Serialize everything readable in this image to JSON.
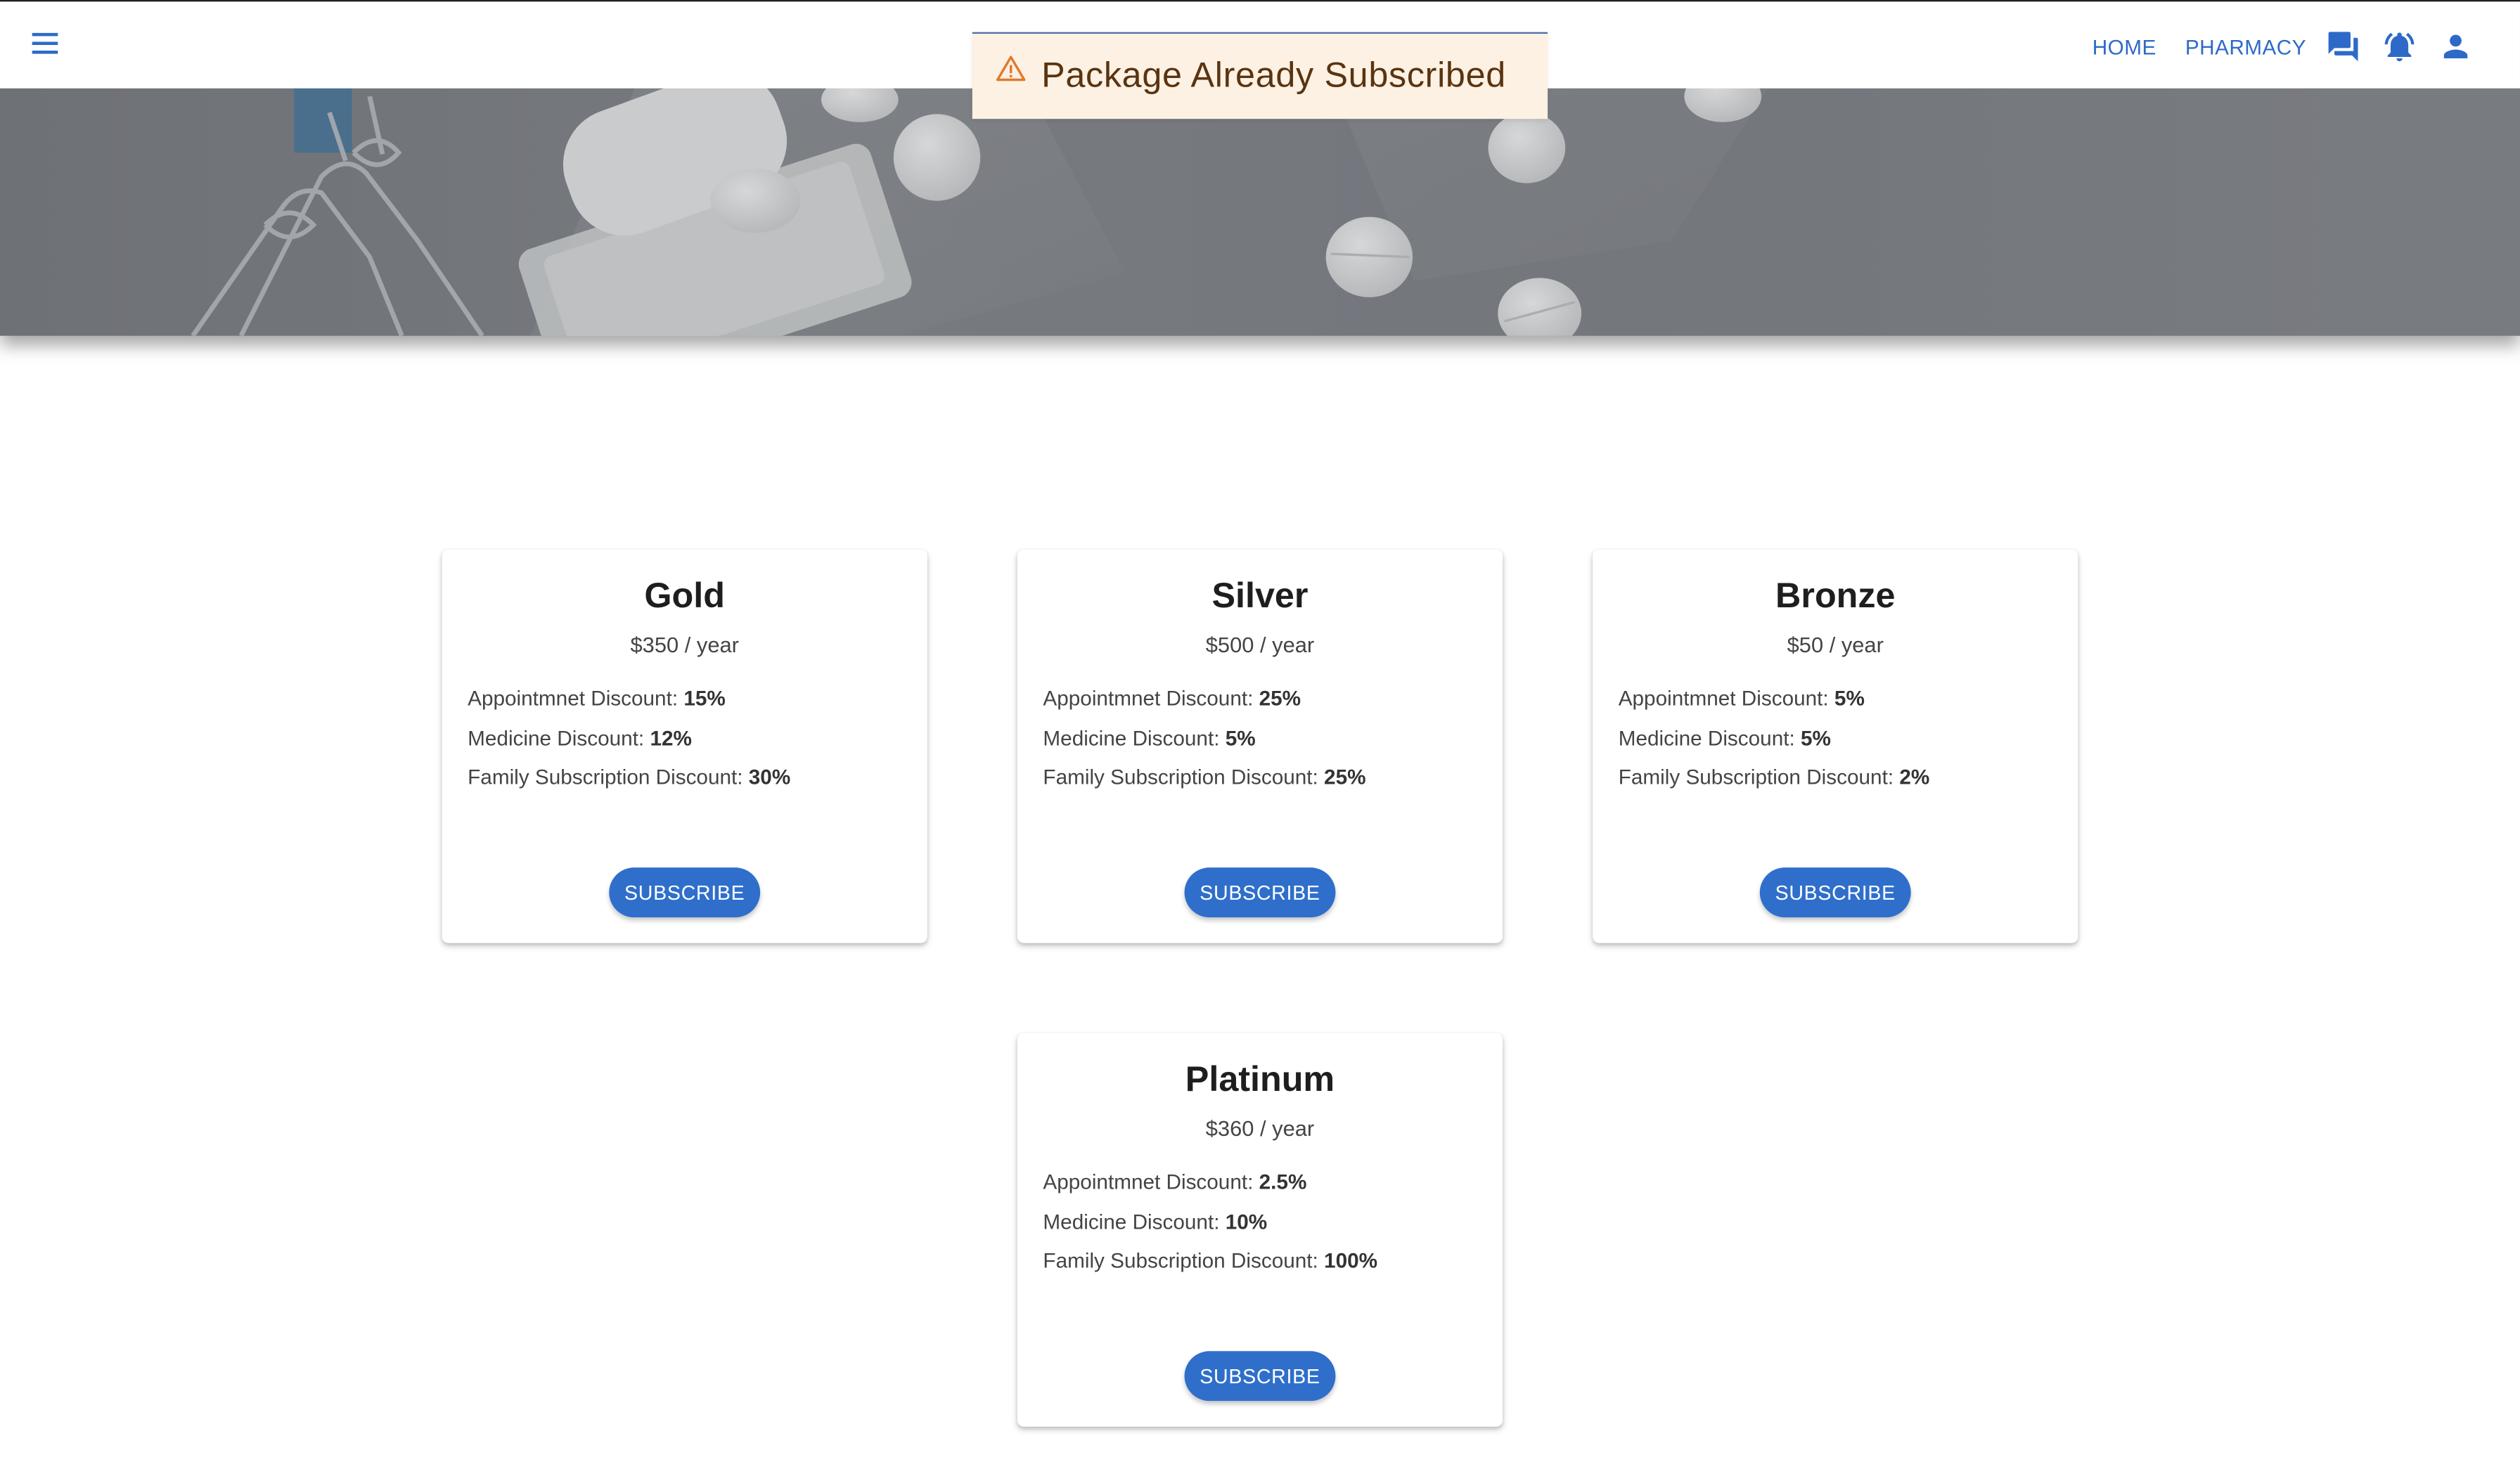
{
  "navbar": {
    "links": [
      {
        "label": "HOME"
      },
      {
        "label": "PHARMACY"
      }
    ],
    "icons": [
      "menu-icon",
      "chat-icon",
      "notifications-icon",
      "account-icon"
    ],
    "link_color": "#2d6ac8"
  },
  "toast": {
    "message": "Package Already Subscribed",
    "icon": "warning-icon",
    "background": "#fdf1e4",
    "text_color": "#5a3410"
  },
  "plans": [
    {
      "name": "Gold",
      "price": "$350",
      "period": " / year",
      "features": [
        {
          "label": "Appointmnet Discount: ",
          "value": "15%"
        },
        {
          "label": "Medicine Discount: ",
          "value": "12%"
        },
        {
          "label": "Family Subscription Discount: ",
          "value": "30%"
        }
      ],
      "button": "SUBSCRIBE"
    },
    {
      "name": "Silver",
      "price": "$500",
      "period": " / year",
      "features": [
        {
          "label": "Appointmnet Discount: ",
          "value": "25%"
        },
        {
          "label": "Medicine Discount: ",
          "value": "5%"
        },
        {
          "label": "Family Subscription Discount: ",
          "value": "25%"
        }
      ],
      "button": "SUBSCRIBE"
    },
    {
      "name": "Bronze",
      "price": "$50",
      "period": " / year",
      "features": [
        {
          "label": "Appointmnet Discount: ",
          "value": "5%"
        },
        {
          "label": "Medicine Discount: ",
          "value": "5%"
        },
        {
          "label": "Family Subscription Discount: ",
          "value": "2%"
        }
      ],
      "button": "SUBSCRIBE"
    },
    {
      "name": "Platinum",
      "price": "$360",
      "period": " / year",
      "features": [
        {
          "label": "Appointmnet Discount: ",
          "value": "2.5%"
        },
        {
          "label": "Medicine Discount: ",
          "value": "10%"
        },
        {
          "label": "Family Subscription Discount: ",
          "value": "100%"
        }
      ],
      "button": "SUBSCRIBE"
    }
  ],
  "colors": {
    "accent": "#2f6fcb",
    "hero_overlay": "#75787d"
  }
}
